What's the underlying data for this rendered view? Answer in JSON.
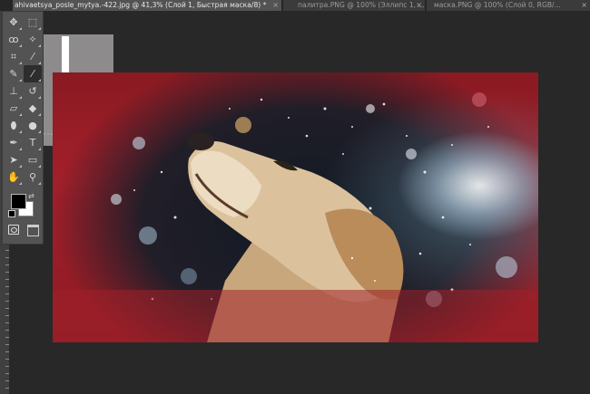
{
  "tabs": [
    {
      "label": "ahivaetsya_posle_mytya.-422.jpg @ 41,3% (Слой 1, Быстрая маска/8) *",
      "active": true,
      "close": "×"
    },
    {
      "label": "палитра.PNG @ 100% (Эллипс 1, ...",
      "active": false,
      "close": "×"
    },
    {
      "label": "маска.PNG @ 100% (Слой 0, RGB/...",
      "active": false,
      "close": "×"
    }
  ],
  "tools": [
    {
      "name": "move-tool",
      "icon": "move-icon",
      "glyph": "✥"
    },
    {
      "name": "marquee-tool",
      "icon": "marquee-icon",
      "glyph": "⬚"
    },
    {
      "name": "lasso-tool",
      "icon": "lasso-icon",
      "glyph": "ꝏ"
    },
    {
      "name": "quick-selection-tool",
      "icon": "quick-selection-icon",
      "glyph": "✧"
    },
    {
      "name": "crop-tool",
      "icon": "crop-icon",
      "glyph": "⌗"
    },
    {
      "name": "eyedropper-tool",
      "icon": "eyedropper-icon",
      "glyph": "⁄"
    },
    {
      "name": "healing-brush-tool",
      "icon": "bandage-icon",
      "glyph": "✎"
    },
    {
      "name": "brush-tool",
      "icon": "brush-icon",
      "glyph": "⁄",
      "selected": true
    },
    {
      "name": "clone-stamp-tool",
      "icon": "stamp-icon",
      "glyph": "⊥"
    },
    {
      "name": "history-brush-tool",
      "icon": "history-brush-icon",
      "glyph": "↺"
    },
    {
      "name": "eraser-tool",
      "icon": "eraser-icon",
      "glyph": "▱"
    },
    {
      "name": "paint-bucket-tool",
      "icon": "bucket-icon",
      "glyph": "◆"
    },
    {
      "name": "blur-tool",
      "icon": "blur-icon",
      "glyph": "⬮"
    },
    {
      "name": "dodge-tool",
      "icon": "dodge-icon",
      "glyph": "●"
    },
    {
      "name": "pen-tool",
      "icon": "pen-icon",
      "glyph": "✒"
    },
    {
      "name": "type-tool",
      "icon": "type-icon",
      "glyph": "T"
    },
    {
      "name": "path-selection-tool",
      "icon": "path-selection-icon",
      "glyph": "➤"
    },
    {
      "name": "rectangle-tool",
      "icon": "rectangle-icon",
      "glyph": "▭"
    },
    {
      "name": "hand-tool",
      "icon": "hand-icon",
      "glyph": "✋"
    },
    {
      "name": "zoom-tool",
      "icon": "zoom-icon",
      "glyph": "⚲"
    }
  ],
  "colors": {
    "foreground": "#000000",
    "background": "#ffffff",
    "app_bg": "#282828",
    "panel": "#535353"
  }
}
